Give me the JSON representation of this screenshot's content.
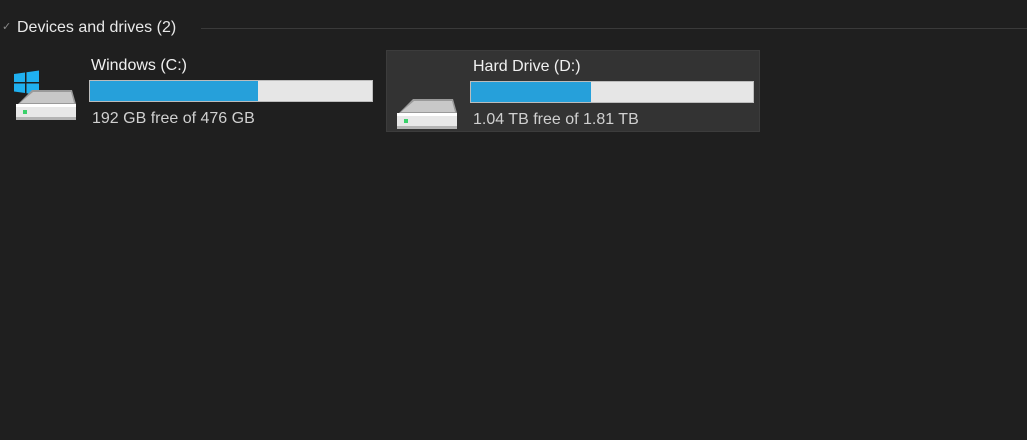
{
  "group": {
    "title": "Devices and drives (2)",
    "chevron_icon": "chevron-down-icon"
  },
  "drives": [
    {
      "name": "Windows (C:)",
      "space_text": "192 GB free of 476 GB",
      "used_fraction": 0.597,
      "icon": "windows-drive-icon",
      "selected": false
    },
    {
      "name": "Hard Drive (D:)",
      "space_text": "1.04 TB free of 1.81 TB",
      "used_fraction": 0.425,
      "icon": "hard-drive-icon",
      "selected": true
    }
  ],
  "colors": {
    "background": "#1f1f1f",
    "bar_fill": "#26a0da",
    "bar_track": "#e6e6e6",
    "selected_tile": "#333333",
    "windows_logo": "#1fb0f0"
  }
}
